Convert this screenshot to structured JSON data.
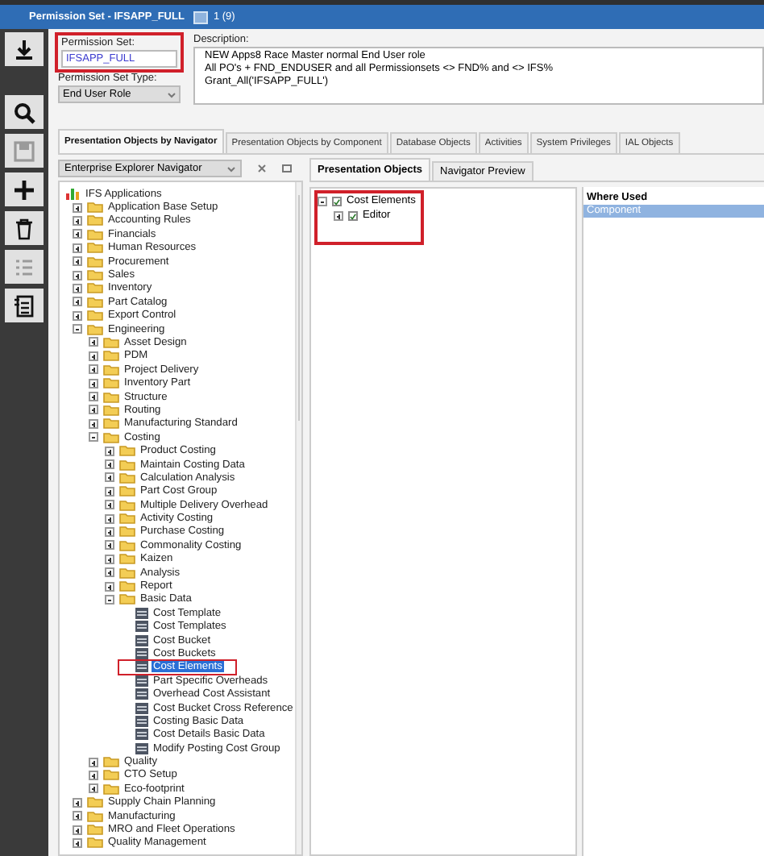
{
  "window": {
    "title": "Permission Set - IFSAPP_FULL",
    "counter": "1 (9)"
  },
  "toolbar": [
    {
      "kind": "download",
      "disabled": false
    },
    {
      "kind": "search",
      "disabled": false
    },
    {
      "kind": "save",
      "disabled": true
    },
    {
      "kind": "add",
      "disabled": false
    },
    {
      "kind": "delete",
      "disabled": false
    },
    {
      "kind": "list",
      "disabled": true
    },
    {
      "kind": "details",
      "disabled": false
    }
  ],
  "header": {
    "permission_set_label": "Permission Set:",
    "permission_set": "IFSAPP_FULL",
    "type_label": "Permission Set Type:",
    "type": "End User Role",
    "description_label": "Description:",
    "description": [
      "NEW Apps8 Race Master normal End User role",
      "All PO's + FND_ENDUSER and all Permissionsets <> FND% and <> IFS%",
      "Grant_All('IFSAPP_FULL')"
    ]
  },
  "tabs": [
    {
      "label": "Presentation Objects by Navigator",
      "selected": true
    },
    {
      "label": "Presentation Objects by Component",
      "selected": false
    },
    {
      "label": "Database Objects",
      "selected": false
    },
    {
      "label": "Activities",
      "selected": false
    },
    {
      "label": "System Privileges",
      "selected": false
    },
    {
      "label": "IAL Objects",
      "selected": false
    }
  ],
  "navigator": {
    "dropdown": "Enterprise Explorer Navigator",
    "tree": [
      {
        "label": "IFS Applications",
        "kind": "root",
        "selected": false,
        "children": [
          {
            "label": "Application Base Setup",
            "kind": "folder",
            "expanded": false,
            "selected": false
          },
          {
            "label": "Accounting Rules",
            "kind": "folder",
            "expanded": false,
            "selected": false
          },
          {
            "label": "Financials",
            "kind": "folder",
            "expanded": false,
            "selected": false
          },
          {
            "label": "Human Resources",
            "kind": "folder",
            "expanded": false,
            "selected": false
          },
          {
            "label": "Procurement",
            "kind": "folder",
            "expanded": false,
            "selected": false
          },
          {
            "label": "Sales",
            "kind": "folder",
            "expanded": false,
            "selected": false
          },
          {
            "label": "Inventory",
            "kind": "folder",
            "expanded": false,
            "selected": false
          },
          {
            "label": "Part Catalog",
            "kind": "folder",
            "expanded": false,
            "selected": false
          },
          {
            "label": "Export Control",
            "kind": "folder",
            "expanded": false,
            "selected": false
          },
          {
            "label": "Engineering",
            "kind": "folder",
            "expanded": true,
            "selected": false,
            "children": [
              {
                "label": "Asset Design",
                "kind": "folder",
                "expanded": false,
                "selected": false
              },
              {
                "label": "PDM",
                "kind": "folder",
                "expanded": false,
                "selected": false
              },
              {
                "label": "Project Delivery",
                "kind": "folder",
                "expanded": false,
                "selected": false
              },
              {
                "label": "Inventory Part",
                "kind": "folder",
                "expanded": false,
                "selected": false
              },
              {
                "label": "Structure",
                "kind": "folder",
                "expanded": false,
                "selected": false
              },
              {
                "label": "Routing",
                "kind": "folder",
                "expanded": false,
                "selected": false
              },
              {
                "label": "Manufacturing Standard",
                "kind": "folder",
                "expanded": false,
                "selected": false
              },
              {
                "label": "Costing",
                "kind": "folder",
                "expanded": true,
                "selected": false,
                "children": [
                  {
                    "label": "Product Costing",
                    "kind": "folder",
                    "expanded": false,
                    "selected": false
                  },
                  {
                    "label": "Maintain Costing Data",
                    "kind": "folder",
                    "expanded": false,
                    "selected": false
                  },
                  {
                    "label": "Calculation Analysis",
                    "kind": "folder",
                    "expanded": false,
                    "selected": false
                  },
                  {
                    "label": "Part Cost Group",
                    "kind": "folder",
                    "expanded": false,
                    "selected": false
                  },
                  {
                    "label": "Multiple Delivery Overhead",
                    "kind": "folder",
                    "expanded": false,
                    "selected": false
                  },
                  {
                    "label": "Activity Costing",
                    "kind": "folder",
                    "expanded": false,
                    "selected": false
                  },
                  {
                    "label": "Purchase Costing",
                    "kind": "folder",
                    "expanded": false,
                    "selected": false
                  },
                  {
                    "label": "Commonality Costing",
                    "kind": "folder",
                    "expanded": false,
                    "selected": false
                  },
                  {
                    "label": "Kaizen",
                    "kind": "folder",
                    "expanded": false,
                    "selected": false
                  },
                  {
                    "label": "Analysis",
                    "kind": "folder",
                    "expanded": false,
                    "selected": false
                  },
                  {
                    "label": "Report",
                    "kind": "folder",
                    "expanded": false,
                    "selected": false
                  },
                  {
                    "label": "Basic Data",
                    "kind": "folder",
                    "expanded": true,
                    "selected": false,
                    "children": [
                      {
                        "label": "Cost Template",
                        "kind": "form",
                        "selected": false
                      },
                      {
                        "label": "Cost Templates",
                        "kind": "form",
                        "selected": false
                      },
                      {
                        "label": "Cost Bucket",
                        "kind": "form",
                        "selected": false
                      },
                      {
                        "label": "Cost Buckets",
                        "kind": "form",
                        "selected": false
                      },
                      {
                        "label": "Cost Elements",
                        "kind": "form",
                        "selected": true
                      },
                      {
                        "label": "Part Specific Overheads",
                        "kind": "form",
                        "selected": false
                      },
                      {
                        "label": "Overhead Cost Assistant",
                        "kind": "form",
                        "selected": false
                      },
                      {
                        "label": "Cost Bucket Cross Reference",
                        "kind": "form",
                        "selected": false
                      },
                      {
                        "label": "Costing Basic Data",
                        "kind": "form",
                        "selected": false
                      },
                      {
                        "label": "Cost Details Basic Data",
                        "kind": "form",
                        "selected": false
                      },
                      {
                        "label": "Modify Posting Cost Group",
                        "kind": "form",
                        "selected": false
                      }
                    ]
                  }
                ]
              },
              {
                "label": "Quality",
                "kind": "folder",
                "expanded": false,
                "selected": false
              },
              {
                "label": "CTO Setup",
                "kind": "folder",
                "expanded": false,
                "selected": false
              },
              {
                "label": "Eco-footprint",
                "kind": "folder",
                "expanded": false,
                "selected": false
              }
            ]
          },
          {
            "label": "Supply Chain Planning",
            "kind": "folder",
            "expanded": false,
            "selected": false
          },
          {
            "label": "Manufacturing",
            "kind": "folder",
            "expanded": false,
            "selected": false
          },
          {
            "label": "MRO and Fleet Operations",
            "kind": "folder",
            "expanded": false,
            "selected": false
          },
          {
            "label": "Quality Management",
            "kind": "folder",
            "expanded": false,
            "selected": false
          }
        ]
      }
    ]
  },
  "detail_tabs": [
    {
      "label": "Presentation Objects",
      "selected": true
    },
    {
      "label": "Navigator Preview",
      "selected": false
    }
  ],
  "objects_tree": [
    {
      "label": "Cost Elements",
      "checked": true,
      "expanded": true,
      "children": [
        {
          "label": "Editor",
          "checked": true,
          "expanded": false
        }
      ]
    }
  ],
  "where_used": {
    "header": "Where Used",
    "rows": [
      {
        "label": "Component",
        "selected": true
      }
    ]
  }
}
